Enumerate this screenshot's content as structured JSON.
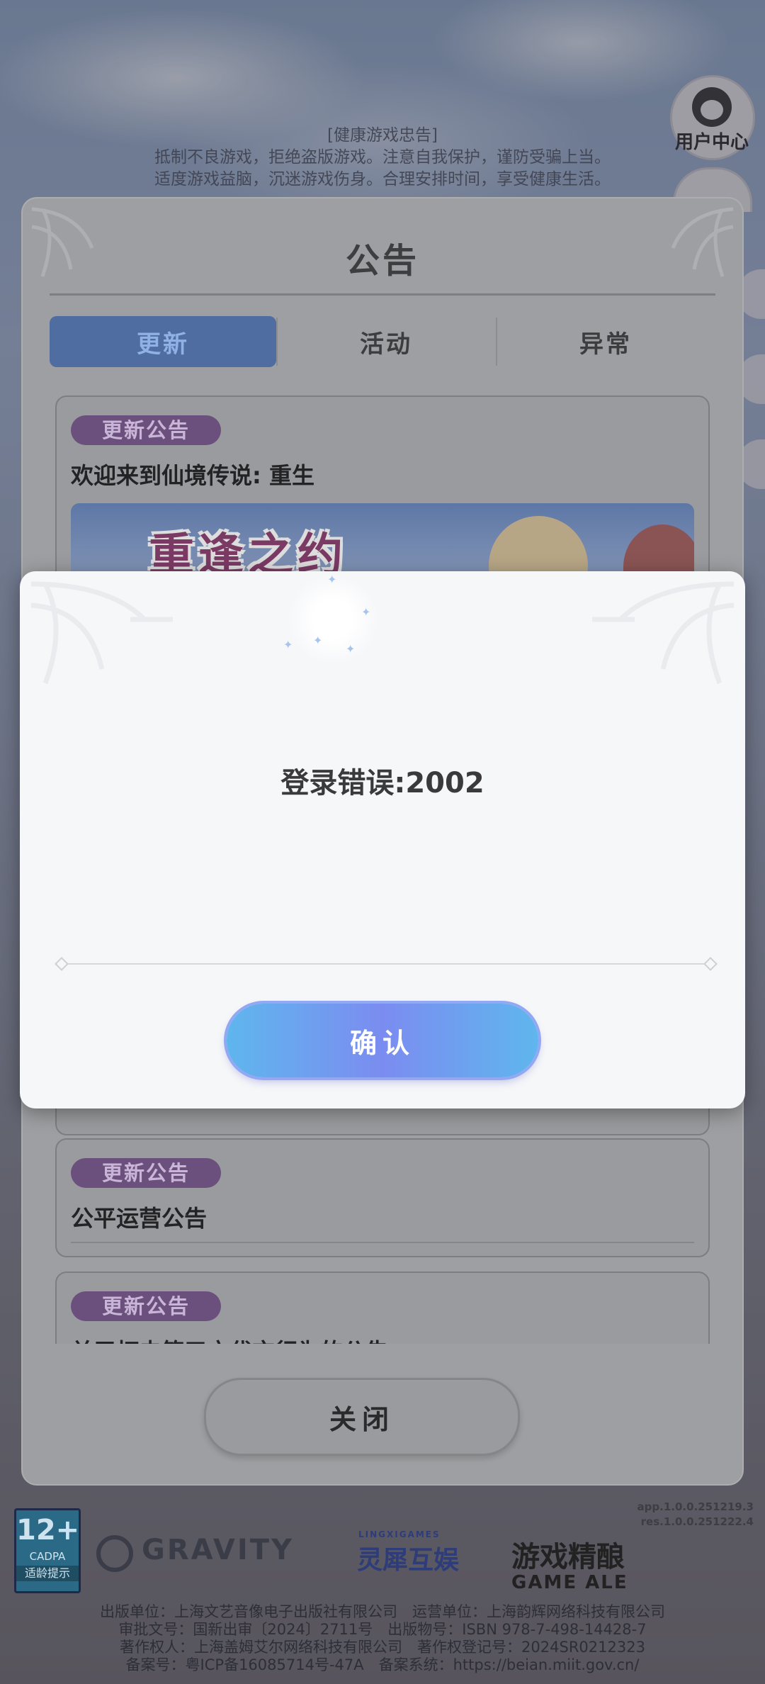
{
  "background": {
    "health_notice_title": "[健康游戏忠告]",
    "health_notice_line1": "抵制不良游戏，拒绝盗版游戏。注意自我保护，谨防受骗上当。",
    "health_notice_line2": "适度游戏益脑，沉迷游戏伤身。合理安排时间，享受健康生活。",
    "user_center_label": "用户中心"
  },
  "announcement": {
    "title": "公告",
    "tabs": [
      {
        "label": "更新",
        "active": true
      },
      {
        "label": "活动",
        "active": false
      },
      {
        "label": "异常",
        "active": false
      }
    ],
    "notices": [
      {
        "badge": "更新公告",
        "title": "欢迎来到仙境传说: 重生",
        "banner_text": "重逢之约"
      },
      {
        "badge": "更新公告",
        "title": "公平运营公告"
      },
      {
        "badge": "更新公告",
        "title": "关于打击第三方代充行为的公告"
      }
    ],
    "close_label": "关闭"
  },
  "dialog": {
    "message": "登录错误:2002",
    "confirm_label": "确认"
  },
  "footer": {
    "version_app": "app.1.0.0.251219.3",
    "version_res": "res.1.0.0.251222.4",
    "age_rating": "12+",
    "age_org": "CADPA",
    "age_tip": "适龄提示",
    "logo_gravity": "GRAVITY",
    "logo_lingxi_en": "LINGXIGAMES",
    "logo_lingxi_cn": "灵犀互娱",
    "logo_game_cn": "游戏精酿",
    "logo_game_en": "GAME ALE",
    "info_line1": "出版单位：上海文艺音像电子出版社有限公司　运营单位：上海韵辉网络科技有限公司",
    "info_line2": "审批文号：国新出审〔2024〕2711号　出版物号：ISBN 978-7-498-14428-7",
    "info_line3": "著作权人：上海盖姆艾尔网络科技有限公司　著作权登记号：2024SR0212323",
    "info_line4": "备案号：粤ICP备16085714号-47A　备案系统：https://beian.miit.gov.cn/"
  }
}
